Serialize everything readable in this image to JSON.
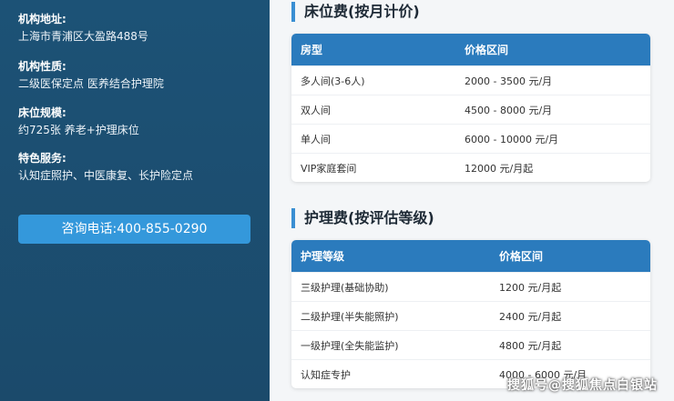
{
  "sidebar": {
    "items": [
      {
        "label": "机构地址:",
        "value": "上海市青浦区大盈路488号"
      },
      {
        "label": "机构性质:",
        "value": "二级医保定点 医养结合护理院"
      },
      {
        "label": "床位规模:",
        "value": "约725张 养老+护理床位"
      },
      {
        "label": "特色服务:",
        "value": "认知症照护、中医康复、长护险定点"
      }
    ],
    "consult_label": "咨询电话:400-855-0290"
  },
  "bed_fee": {
    "title": "床位费(按月计价)",
    "headers": [
      "房型",
      "价格区间"
    ],
    "rows": [
      [
        "多人间(3-6人)",
        "2000 - 3500 元/月"
      ],
      [
        "双人间",
        "4500 - 8000 元/月"
      ],
      [
        "单人间",
        "6000 - 10000 元/月"
      ],
      [
        "VIP家庭套间",
        "12000 元/月起"
      ]
    ]
  },
  "care_fee": {
    "title": "护理费(按评估等级)",
    "headers": [
      "护理等级",
      "价格区间"
    ],
    "rows": [
      [
        "三级护理(基础协助)",
        "1200 元/月起"
      ],
      [
        "二级护理(半失能照护)",
        "2400 元/月起"
      ],
      [
        "一级护理(全失能监护)",
        "4800 元/月起"
      ],
      [
        "认知症专护",
        "4000 - 6000 元/月"
      ]
    ]
  },
  "watermark": "搜狐号@搜狐焦点白银站",
  "colors": {
    "sidebar_bg": "#1c5276",
    "accent": "#3498db",
    "table_header": "#2b7bbd"
  }
}
